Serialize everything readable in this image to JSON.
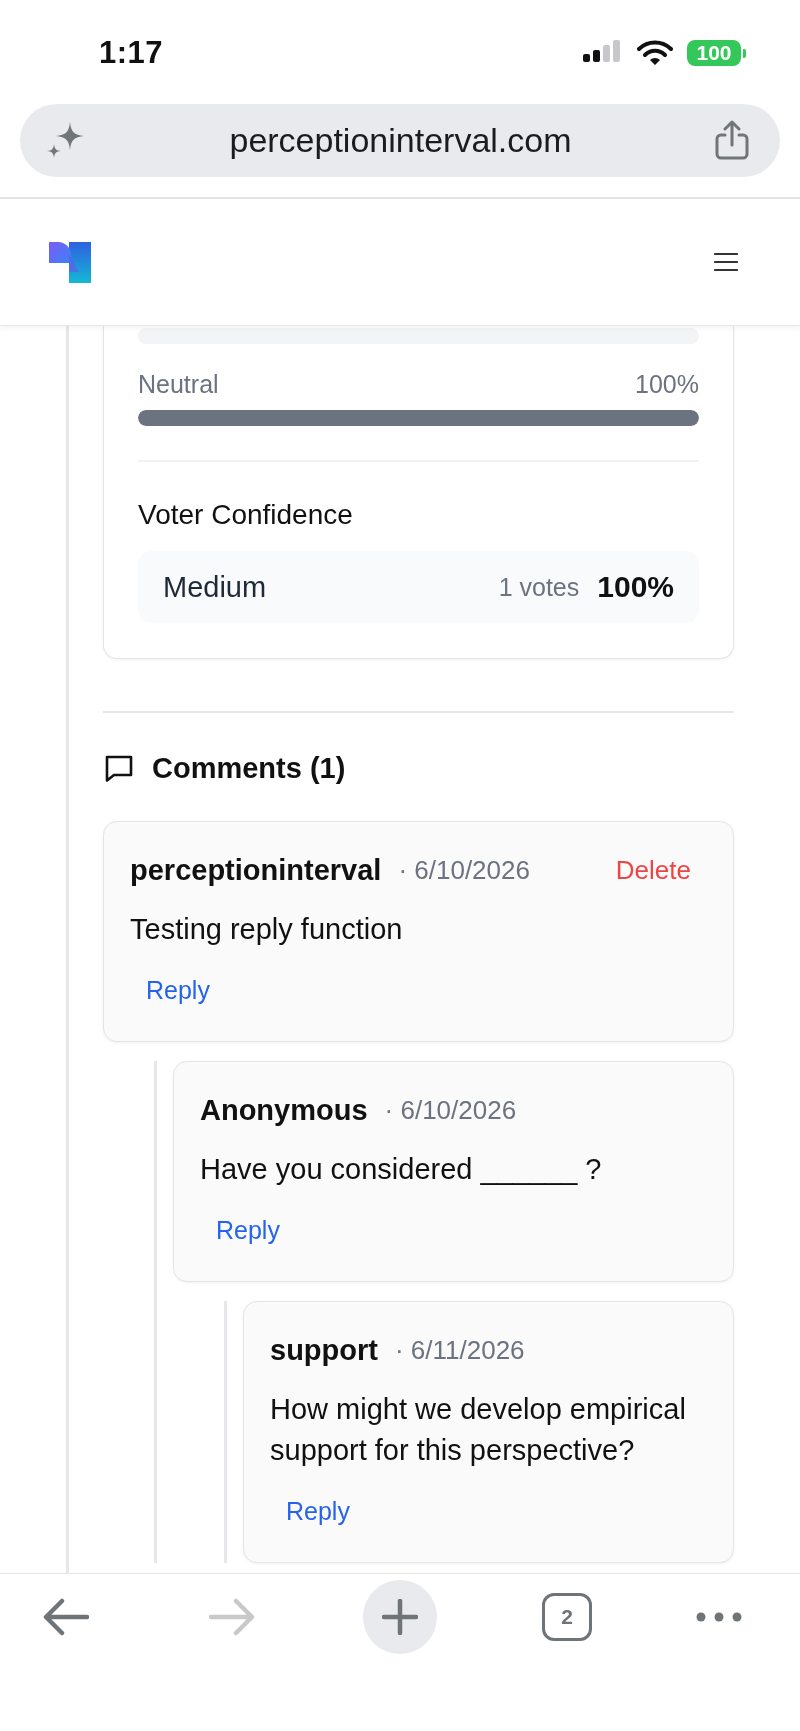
{
  "status_bar": {
    "time": "1:17",
    "battery": "100"
  },
  "address_bar": {
    "url": "perceptioninterval.com"
  },
  "results": {
    "bars": [
      {
        "level": 0
      },
      {
        "label": "Neutral",
        "value": "100%",
        "level": 1
      }
    ],
    "confidence": {
      "title": "Voter Confidence",
      "rows": [
        {
          "label": "Medium",
          "votes": "1 votes",
          "percent": "100%"
        }
      ]
    }
  },
  "comments": {
    "title": "Comments (1)",
    "items": [
      {
        "author": "perceptioninterval",
        "date": "· 6/10/2026",
        "delete": "Delete",
        "text": "Testing reply function",
        "reply": "Reply",
        "children": [
          {
            "author": "Anonymous",
            "date": "· 6/10/2026",
            "text": "Have you considered ______ ?",
            "reply": "Reply",
            "children": [
              {
                "author": "support",
                "date": "· 6/11/2026",
                "text": "How might we develop empirical support for this perspective?",
                "reply": "Reply"
              }
            ]
          }
        ]
      }
    ]
  },
  "toolbar": [
    {
      "kind": "back",
      "disabled": false
    },
    {
      "kind": "forward",
      "disabled": true
    },
    {
      "kind": "new_tab",
      "disabled": false
    },
    {
      "kind": "tabs",
      "label": "2",
      "disabled": false
    },
    {
      "kind": "more",
      "disabled": false
    }
  ]
}
